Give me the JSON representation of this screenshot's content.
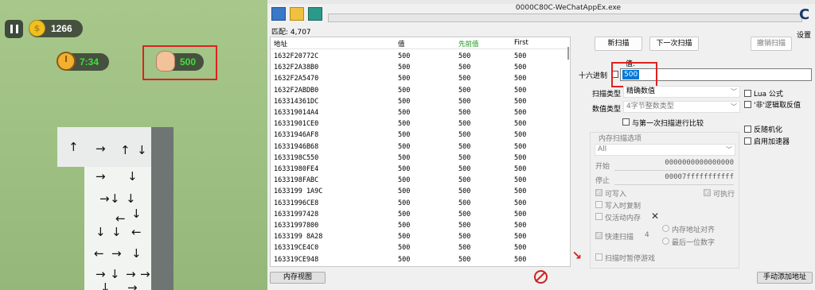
{
  "game": {
    "coins": "1266",
    "timer": "7:34",
    "moves": "500",
    "arrows": [
      "↑",
      "→",
      "↑",
      "↓",
      "→",
      "↓",
      "→",
      "↓",
      "↓",
      "↓",
      "←",
      "↓",
      "↓",
      "←",
      "←",
      "→",
      "↓",
      "→",
      "↓",
      "→",
      "→",
      "↓",
      "→"
    ]
  },
  "ce": {
    "process_title": "0000C80C-WeChatAppEx.exe",
    "settings_label": "设置",
    "found_label": "匹配: 4,707",
    "columns": [
      "地址",
      "值",
      "先前值",
      "First"
    ],
    "rows": [
      [
        "1632F20772C",
        "500",
        "500",
        "500"
      ],
      [
        "1632F2A38B0",
        "500",
        "500",
        "500"
      ],
      [
        "1632F2A5470",
        "500",
        "500",
        "500"
      ],
      [
        "1632F2ABDB0",
        "500",
        "500",
        "500"
      ],
      [
        "163314361DC",
        "500",
        "500",
        "500"
      ],
      [
        "163319014A4",
        "500",
        "500",
        "500"
      ],
      [
        "16331901CE0",
        "500",
        "500",
        "500"
      ],
      [
        "16331946AF8",
        "500",
        "500",
        "500"
      ],
      [
        "16331946B68",
        "500",
        "500",
        "500"
      ],
      [
        "1633198C550",
        "500",
        "500",
        "500"
      ],
      [
        "16331980FE4",
        "500",
        "500",
        "500"
      ],
      [
        "1633198FABC",
        "500",
        "500",
        "500"
      ],
      [
        "1633199 1A9C",
        "500",
        "500",
        "500"
      ],
      [
        "16331996CE8",
        "500",
        "500",
        "500"
      ],
      [
        "16331997428",
        "500",
        "500",
        "500"
      ],
      [
        "16331997800",
        "500",
        "500",
        "500"
      ],
      [
        "1633199 8A28",
        "500",
        "500",
        "500"
      ],
      [
        "163319CE4C0",
        "500",
        "500",
        "500"
      ],
      [
        "163319CE948",
        "500",
        "500",
        "500"
      ]
    ],
    "btn_new_scan": "新扫描",
    "btn_next_scan": "下一次扫描",
    "btn_undo_scan": "撤销扫描",
    "value_label": "值:",
    "hex_label": "十六进制",
    "value_input": "500",
    "scan_type_label": "扫描类型",
    "scan_type_value": "精确数值",
    "value_type_label": "数值类型",
    "value_type_value": "4字节整数类型",
    "compare_first": "与第一次扫描进行比较",
    "lua_formula": "Lua 公式",
    "not_logic": "'非'逻辑取反值",
    "unrandomizer": "反随机化",
    "speedhack": "启用加速器",
    "mem_options_title": "内存扫描选项",
    "region_value": "All",
    "start_label": "开始",
    "start_value": "0000000000000000",
    "stop_label": "停止",
    "stop_value": "00007fffffffffff",
    "writable": "可写入",
    "executable": "可执行",
    "copy_on_write": "写入时复制",
    "active_memory": "仅活动内存",
    "fast_scan": "快速扫描",
    "fast_scan_value": "4",
    "align_label": "内存地址对齐",
    "last_digits_label": "最后一位数字",
    "pause_game": "扫描时暂停游戏",
    "btn_memory_view": "内存视图",
    "btn_add_address": "手动添加地址"
  }
}
